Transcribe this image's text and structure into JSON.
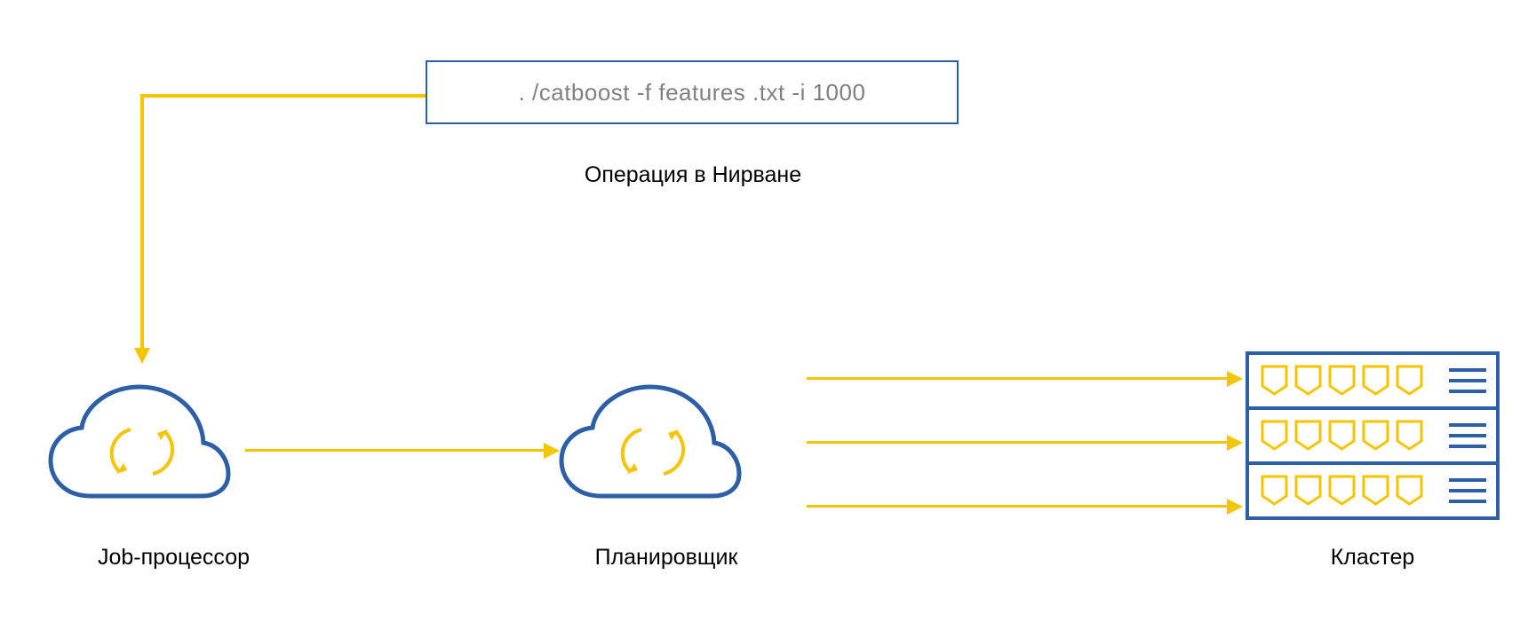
{
  "command_box": {
    "text": ". /catboost -f features .txt -i 1000",
    "caption": "Операция в Нирване"
  },
  "nodes": {
    "job_processor": {
      "label": "Job-процессор",
      "icon": "cloud-refresh"
    },
    "planner": {
      "label": "Планировщик",
      "icon": "cloud-refresh"
    },
    "cluster": {
      "label": "Кластер",
      "icon": "server-rack"
    }
  },
  "arrows": [
    {
      "from": "command_box",
      "to": "job_processor",
      "shape": "elbow"
    },
    {
      "from": "job_processor",
      "to": "planner",
      "shape": "straight"
    },
    {
      "from": "planner",
      "to": "cluster",
      "shape": "triple"
    }
  ],
  "colors": {
    "border_blue": "#2c5fa5",
    "arrow_yellow": "#f6c400",
    "text_gray": "#808080"
  }
}
